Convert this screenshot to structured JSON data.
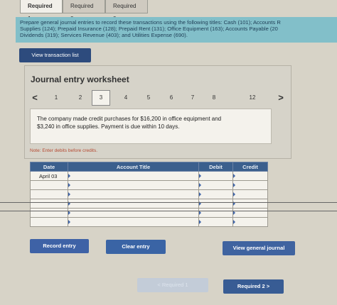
{
  "tabs": [
    "Required 1",
    "Required 2",
    "Required 3"
  ],
  "instructions": {
    "line1": "Prepare general journal entries to record these transactions using the following titles: Cash (101); Accounts R",
    "line2": "Supplies (124); Prepaid Insurance (128); Prepaid Rent (131); Office Equipment (163); Accounts Payable (20",
    "line3": "Dividends (319); Services Revenue (403); and Utilities Expense (690)."
  },
  "view_transaction_list": "View transaction list",
  "worksheet": {
    "title": "Journal entry worksheet",
    "pages": [
      "1",
      "2",
      "3",
      "4",
      "5",
      "6",
      "7",
      "8",
      "12"
    ],
    "current_page": "3",
    "prev_arrow": "<",
    "next_arrow": ">",
    "description_line1": "The company made credit purchases for $16,200 in office equipment and",
    "description_line2": "$3,240 in office supplies. Payment is due within 10 days."
  },
  "note": "Note: Enter debits before credits.",
  "table": {
    "headers": [
      "Date",
      "Account Title",
      "Debit",
      "Credit"
    ],
    "rows": [
      {
        "date": "April 03",
        "account": "",
        "debit": "",
        "credit": ""
      },
      {
        "date": "",
        "account": "",
        "debit": "",
        "credit": ""
      },
      {
        "date": "",
        "account": "",
        "debit": "",
        "credit": ""
      },
      {
        "date": "",
        "account": "",
        "debit": "",
        "credit": ""
      },
      {
        "date": "",
        "account": "",
        "debit": "",
        "credit": ""
      },
      {
        "date": "",
        "account": "",
        "debit": "",
        "credit": ""
      }
    ]
  },
  "buttons": {
    "record_entry": "Record entry",
    "clear_entry": "Clear entry",
    "view_general_journal": "View general journal",
    "prev": "< Required 1",
    "next": "Required 2 >"
  }
}
